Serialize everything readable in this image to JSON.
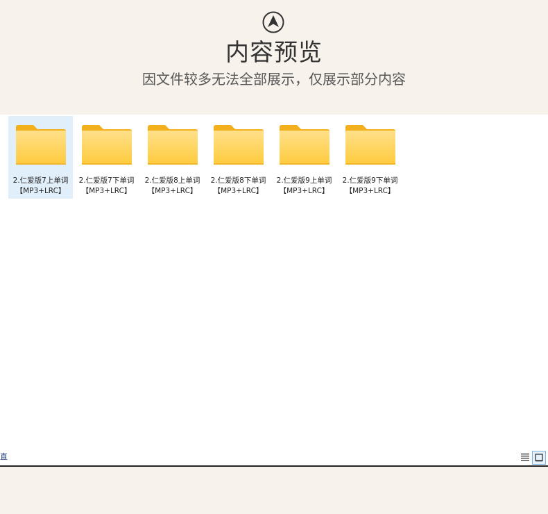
{
  "header": {
    "logo_icon": "compass-arrow-icon",
    "title": "内容预览",
    "subtitle": "因文件较多无法全部展示，仅展示部分内容"
  },
  "explorer": {
    "folders": [
      {
        "line1": "2.仁爱版7上单词",
        "line2": "【MP3+LRC】",
        "selected": true
      },
      {
        "line1": "2.仁爱版7下单词",
        "line2": "【MP3+LRC】",
        "selected": false
      },
      {
        "line1": "2.仁爱版8上单词",
        "line2": "【MP3+LRC】",
        "selected": false
      },
      {
        "line1": "2.仁爱版8下单词",
        "line2": "【MP3+LRC】",
        "selected": false
      },
      {
        "line1": "2.仁爱版9上单词",
        "line2": "【MP3+LRC】",
        "selected": false
      },
      {
        "line1": "2.仁爱版9下单词",
        "line2": "【MP3+LRC】",
        "selected": false
      }
    ],
    "status_left_glyph": "直",
    "view_buttons": [
      "details-view-icon",
      "large-icons-view-icon"
    ]
  },
  "colors": {
    "page_bg": "#f7f3ec",
    "explorer_bg": "#ffffff",
    "selection_bg": "#e1effa",
    "folder_back": "#f5b91f",
    "folder_front": "#ffd45e"
  }
}
